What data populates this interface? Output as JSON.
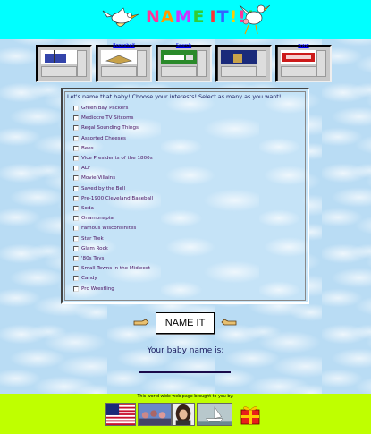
{
  "header": {
    "title": "NAME IT!!!",
    "title_letters": [
      "N",
      "A",
      "M",
      "E",
      " ",
      "I",
      "T",
      "!",
      "!",
      "!"
    ],
    "title_colors": [
      "#ff3399",
      "#ff9900",
      "#cc33ff",
      "#33cc33",
      "#000000",
      "#ff3333",
      "#3366ff",
      "#ffcc00",
      "#ff3399",
      "#33cc33"
    ],
    "background": "#00ffff"
  },
  "ads": [
    {
      "caption": "",
      "image": "flag-ad-icon"
    },
    {
      "caption": "Bookshelf",
      "image": "book-ad-icon"
    },
    {
      "caption": "Search",
      "image": "search-ad-icon"
    },
    {
      "caption": "",
      "image": "window-ad-icon"
    },
    {
      "caption": "www",
      "image": "banner-ad-icon"
    }
  ],
  "form": {
    "intro": "Let's name that baby! Choose your interests! Select as many as you want!",
    "interests": [
      "Green Bay Packers",
      "Mediocre TV Sitcoms",
      "Regal Sounding Things",
      "Assorted Cheeses",
      "Bees",
      "Vice Presidents of the 1800s",
      "ALF",
      "Movie Villains",
      "Saved by the Bell",
      "Pre-1900 Cleveland Baseball",
      "Soda",
      "Onamonapia",
      "Famous Wisconsinites",
      "Star Trek",
      "Glam Rock",
      "'80s Toys",
      "Small Towns in the Midwest",
      "Candy",
      "Pro Wrestling"
    ],
    "button_label": "NAME IT",
    "result_label": "Your baby name is:",
    "result_value": ""
  },
  "footer": {
    "tagline": "This world wide web page brought to you by:",
    "sponsors": [
      "us-flag-icon",
      "crowd-photo",
      "woman-portrait",
      "boat-photo",
      "gift-box-icon"
    ],
    "background": "#bfff00"
  }
}
